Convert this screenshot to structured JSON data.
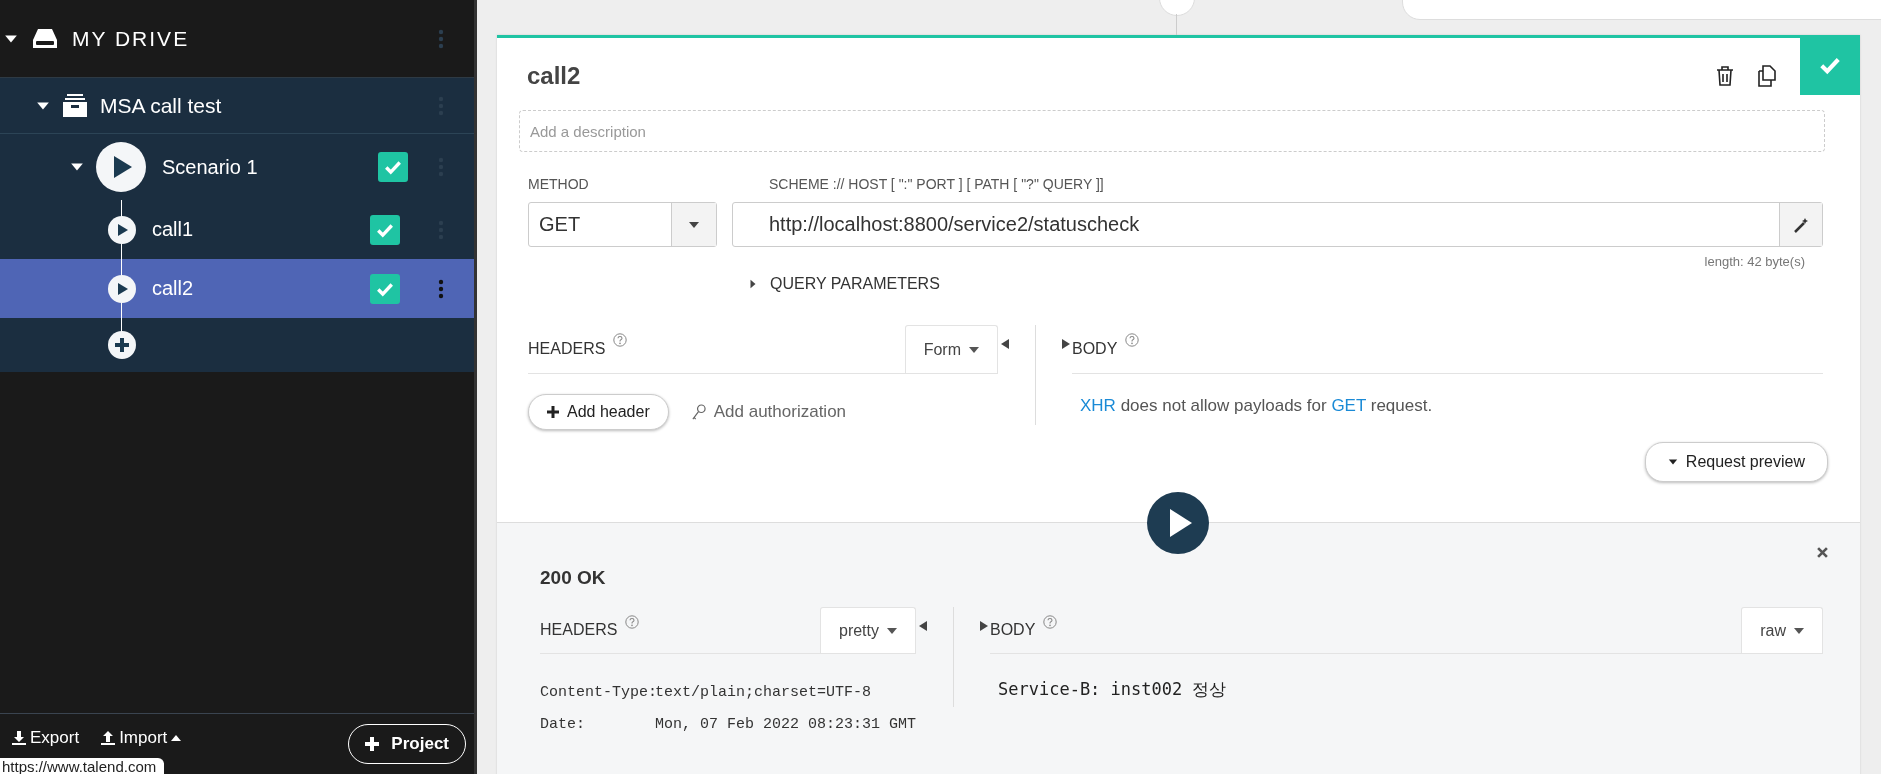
{
  "sidebar": {
    "drive": {
      "label": "MY DRIVE",
      "expanded": true,
      "children": [
        {
          "label": "MSA call test",
          "expanded": true,
          "children": [
            {
              "label": "Scenario 1",
              "expanded": true,
              "enabled": true,
              "children": [
                {
                  "label": "call1",
                  "enabled": true,
                  "selected": false
                },
                {
                  "label": "call2",
                  "enabled": true,
                  "selected": true
                }
              ]
            }
          ]
        }
      ]
    },
    "footer": {
      "export": "Export",
      "import": "Import",
      "new_project": "Project"
    },
    "tooltip": "https://www.talend.com"
  },
  "request": {
    "name": "call2",
    "enabled": true,
    "description": {
      "placeholder": "Add a description"
    },
    "method_label": "METHOD",
    "method": "GET",
    "url_label": "SCHEME :// HOST [ \":\" PORT ] [ PATH [ \"?\" QUERY ]]",
    "url": "http://localhost:8800/service2/statuscheck",
    "length": "length: 42 byte(s)",
    "query_parameters": {
      "label": "QUERY PARAMETERS",
      "expanded": false
    },
    "headers": {
      "label": "HEADERS",
      "mode": "Form",
      "add_header": "Add header",
      "add_authorization": "Add authorization"
    },
    "body": {
      "label": "BODY",
      "message": [
        {
          "kind": "link",
          "text": "XHR"
        },
        {
          "kind": "plain",
          "text": " does not allow payloads for "
        },
        {
          "kind": "link",
          "text": "GET"
        },
        {
          "kind": "plain",
          "text": " request."
        }
      ]
    },
    "preview": {
      "label": "Request preview",
      "expanded": false
    }
  },
  "response": {
    "status": "200 OK",
    "headers_label": "HEADERS",
    "headers_mode": "pretty",
    "body_label": "BODY",
    "body_mode": "raw",
    "headers": [
      {
        "name": "Content-Type:",
        "value": "text/plain;charset=UTF-8"
      },
      {
        "name": "Date:",
        "value": "Mon, 07 Feb 2022 08:23:31 GMT"
      }
    ],
    "body": "Service-B: inst002 정상"
  }
}
